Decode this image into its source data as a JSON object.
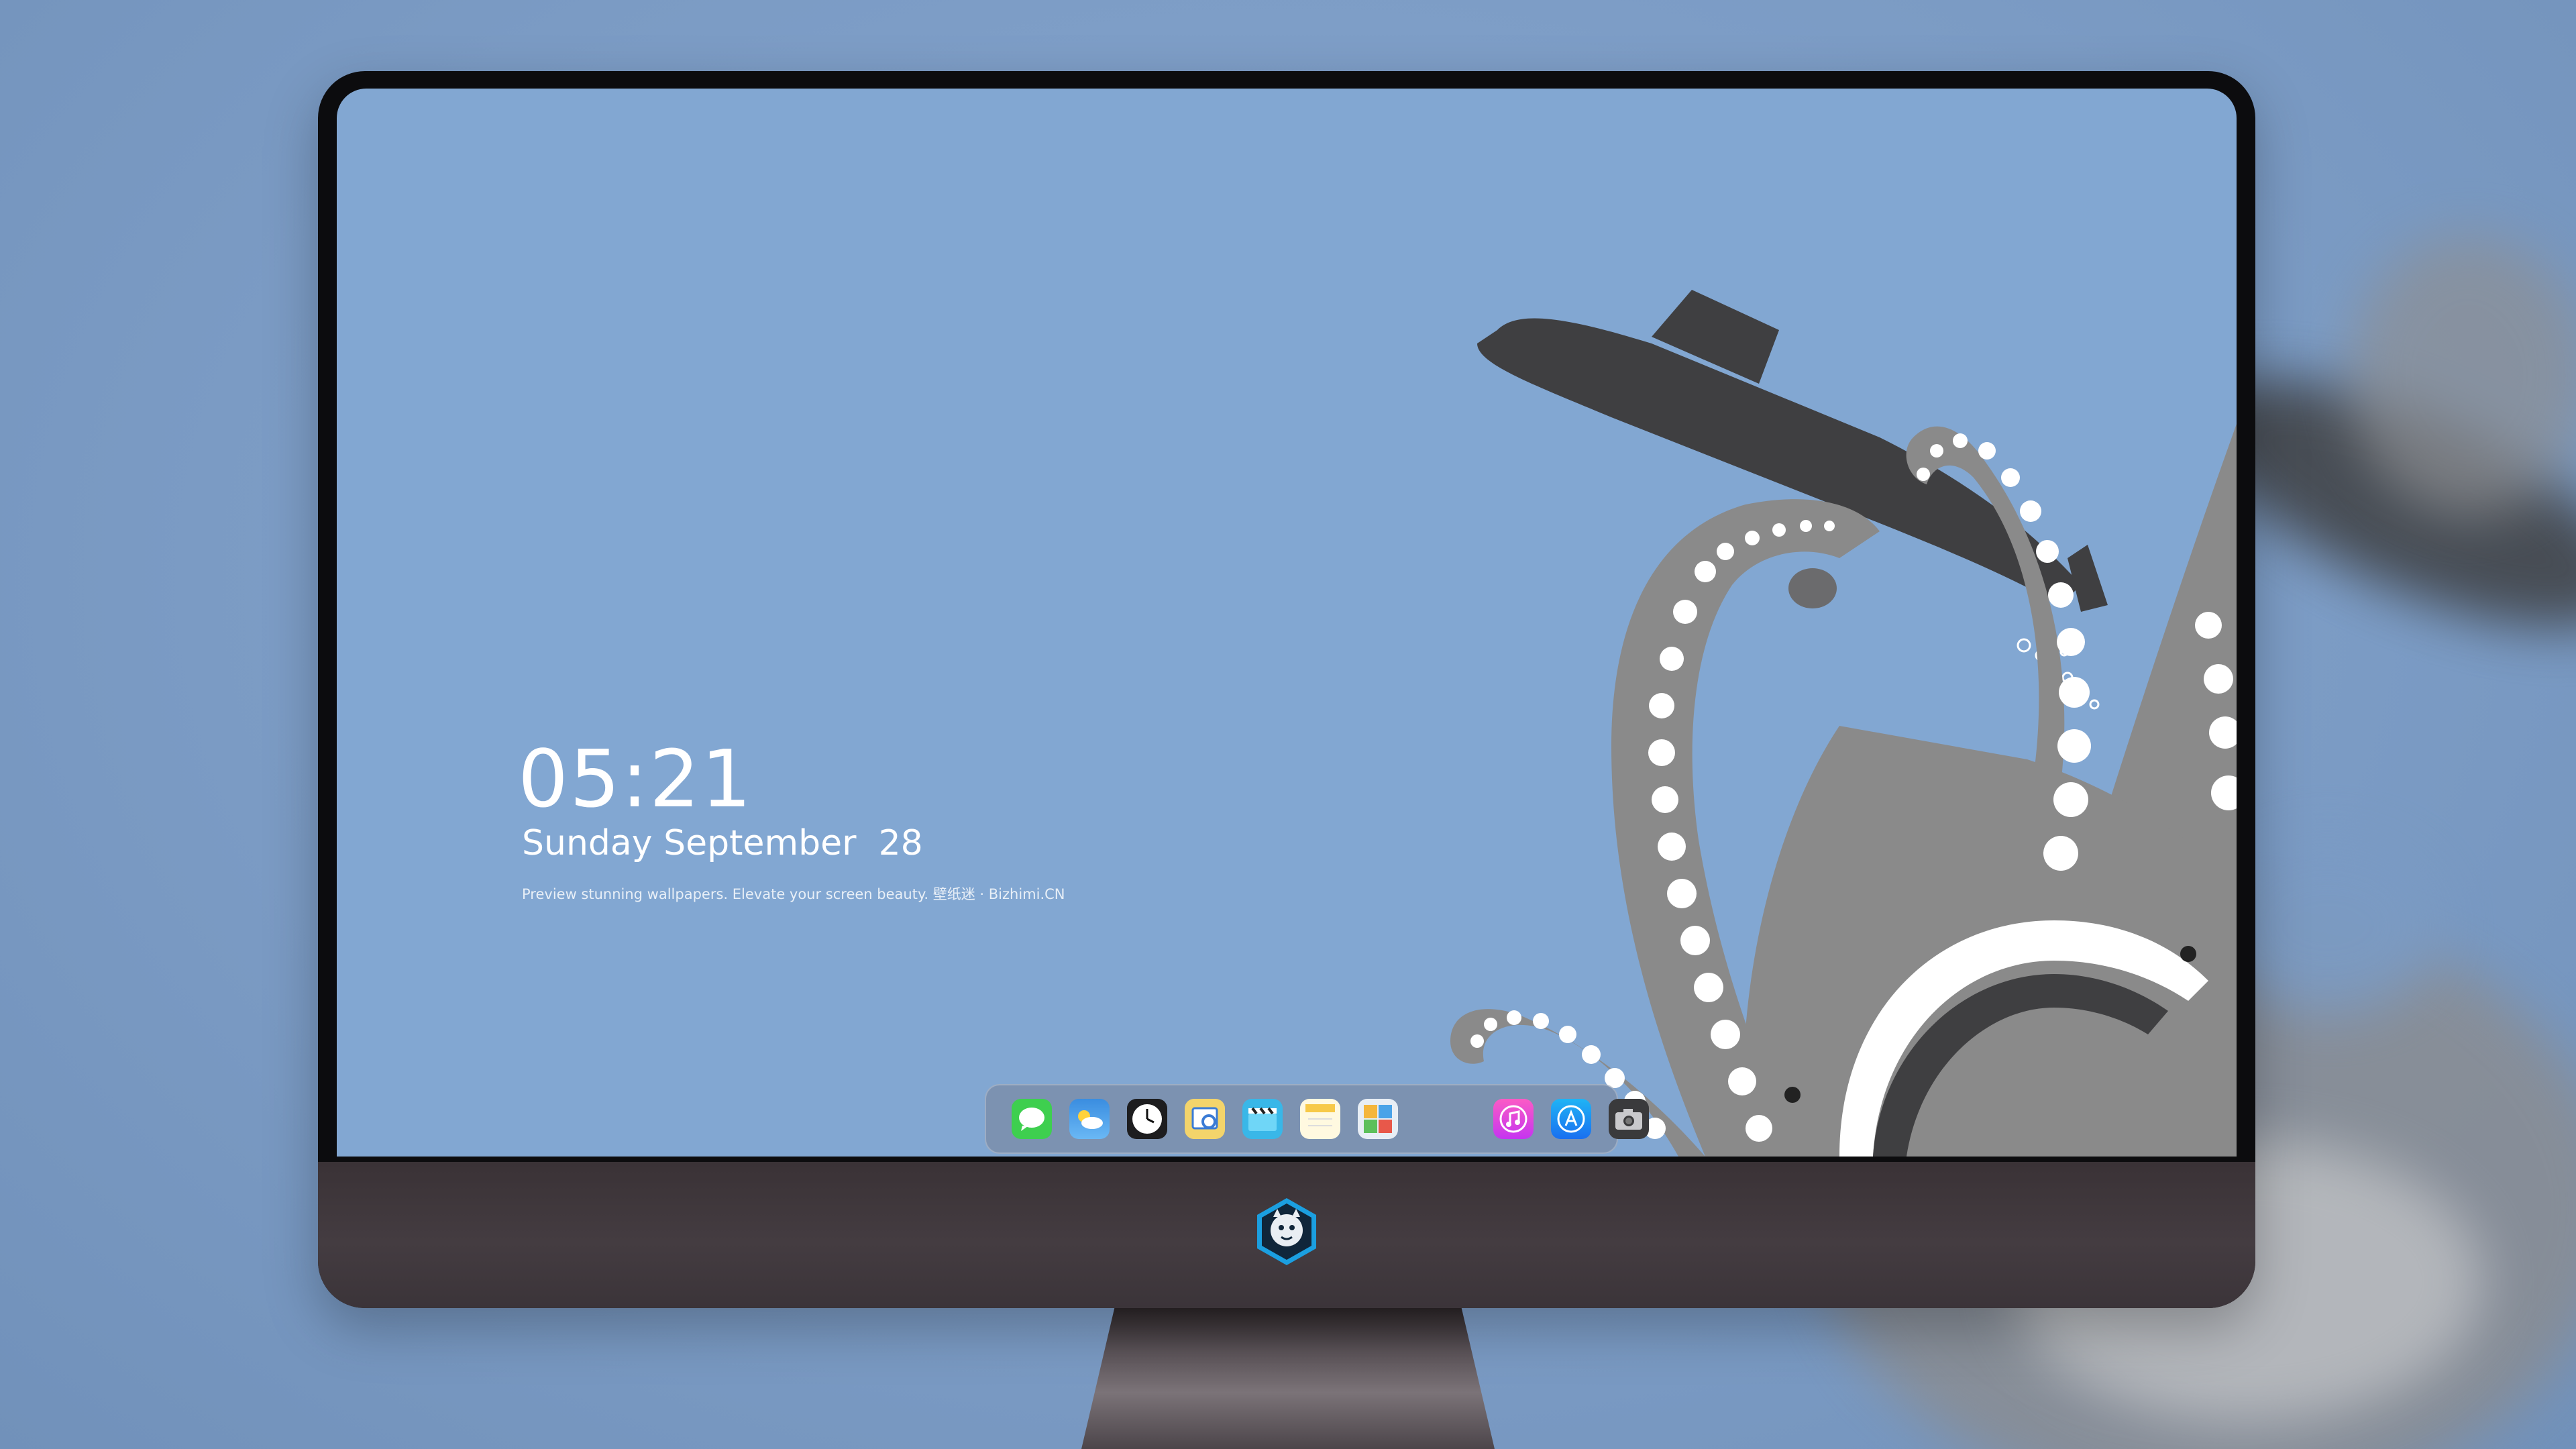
{
  "lockscreen": {
    "time": "05:21",
    "date": "Sunday September  28",
    "tagline": "Preview stunning wallpapers. Elevate your screen beauty. 壁纸迷 · Bizhimi.CN"
  },
  "dock": {
    "apps": [
      {
        "icon": "messages-icon"
      },
      {
        "icon": "weather-icon"
      },
      {
        "icon": "clock-icon"
      },
      {
        "icon": "preview-icon"
      },
      {
        "icon": "clips-icon"
      },
      {
        "icon": "notes-icon"
      },
      {
        "icon": "photo-booth-icon"
      },
      {
        "icon": "music-icon"
      },
      {
        "icon": "app-store-icon"
      },
      {
        "icon": "camera-icon"
      }
    ]
  },
  "colors": {
    "screen_bg": "#82a7d2",
    "octopus": "#8a8a8a",
    "submarine": "#3f3f41",
    "suckers": "#ffffff"
  }
}
